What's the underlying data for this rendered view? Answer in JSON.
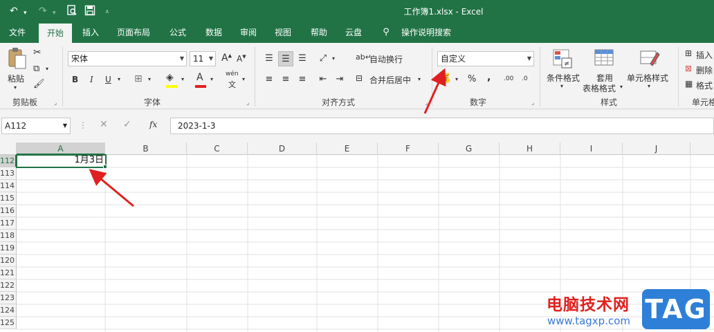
{
  "window": {
    "title": "工作簿1.xlsx  -  Excel",
    "quick_access": [
      "undo-icon",
      "redo-icon",
      "print-preview-icon",
      "save-icon",
      "customize-icon"
    ]
  },
  "tabs": [
    {
      "label": "文件",
      "active": false
    },
    {
      "label": "开始",
      "active": true
    },
    {
      "label": "插入",
      "active": false
    },
    {
      "label": "页面布局",
      "active": false
    },
    {
      "label": "公式",
      "active": false
    },
    {
      "label": "数据",
      "active": false
    },
    {
      "label": "审阅",
      "active": false
    },
    {
      "label": "视图",
      "active": false
    },
    {
      "label": "帮助",
      "active": false
    },
    {
      "label": "云盘",
      "active": false
    },
    {
      "label": "操作说明搜索",
      "active": false
    }
  ],
  "ribbon": {
    "clipboard": {
      "paste_label": "粘贴",
      "group_label": "剪贴板"
    },
    "font": {
      "font_name": "宋体",
      "font_size": "11",
      "grow_label": "A",
      "shrink_label": "A",
      "bold": "B",
      "italic": "I",
      "underline": "U",
      "font_color_label": "A",
      "phonetic": "wén",
      "group_label": "字体"
    },
    "alignment": {
      "wrap_label": "自动换行",
      "merge_label": "合并后居中",
      "group_label": "对齐方式"
    },
    "number": {
      "format": "自定义",
      "percent": "%",
      "comma": ",",
      "inc_decimal": ".00",
      "dec_decimal": ".0",
      "group_label": "数字"
    },
    "styles": {
      "conditional_label": "条件格式",
      "table_label_1": "套用",
      "table_label_2": "表格格式",
      "cell_styles_label": "单元格样式",
      "group_label": "样式"
    },
    "cells": {
      "insert_label": "插入",
      "delete_label": "删除",
      "format_label": "格式",
      "group_label": "单元格"
    }
  },
  "formula_bar": {
    "name_box": "A112",
    "formula": "2023-1-3",
    "fx_label": "fx"
  },
  "grid": {
    "columns": [
      "A",
      "B",
      "C",
      "D",
      "E",
      "F",
      "G",
      "H",
      "I",
      "J"
    ],
    "rows": [
      "112",
      "113",
      "114",
      "115",
      "116",
      "117",
      "118",
      "119",
      "120",
      "121",
      "122",
      "123",
      "124",
      "125"
    ],
    "active_cell_value": "1月3日"
  },
  "watermark": {
    "cn": "电脑技术网",
    "url": "www.tagxp.com",
    "tag": "TAG"
  },
  "colors": {
    "accent": "#217346",
    "arrow": "#e02020"
  }
}
